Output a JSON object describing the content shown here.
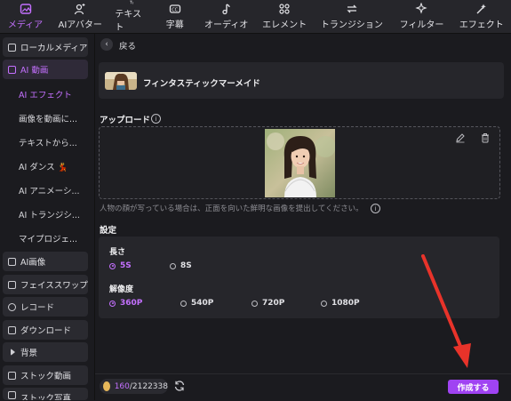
{
  "toolbar": {
    "tabs": [
      {
        "label": "メディア",
        "icon": "media-icon"
      },
      {
        "label": "AIアバター",
        "icon": "avatar-icon"
      },
      {
        "label": "テキスト",
        "icon": "text-icon"
      },
      {
        "label": "字幕",
        "icon": "subtitle-icon"
      },
      {
        "label": "オーディオ",
        "icon": "audio-icon"
      },
      {
        "label": "エレメント",
        "icon": "element-icon"
      },
      {
        "label": "トランジション",
        "icon": "transition-icon"
      },
      {
        "label": "フィルター",
        "icon": "filter-icon"
      },
      {
        "label": "エフェクト",
        "icon": "effect-icon"
      }
    ],
    "active_index": 0
  },
  "sidebar": {
    "items": [
      {
        "label": "ローカルメディア"
      },
      {
        "label": "AI 動画"
      },
      {
        "label": "AI画像"
      },
      {
        "label": "フェイススワップ"
      },
      {
        "label": "レコード"
      },
      {
        "label": "ダウンロード"
      },
      {
        "label": "背景"
      },
      {
        "label": "ストック動画"
      },
      {
        "label": "ストック写真"
      }
    ],
    "subitems": [
      {
        "label": "AI エフェクト"
      },
      {
        "label": "画像を動画に..."
      },
      {
        "label": "テキストから..."
      },
      {
        "label": "AI ダンス 💃"
      },
      {
        "label": "AI アニメーシ..."
      },
      {
        "label": "AI トランジシ..."
      },
      {
        "label": "マイプロジェ..."
      }
    ]
  },
  "main": {
    "back_label": "戻る",
    "effect_title": "フィンタスティックマーメイド",
    "upload_label": "アップロード",
    "hint": "人物の顔が写っている場合は、正面を向いた鮮明な画像を提出してください。",
    "settings_label": "設定",
    "length_label": "長さ",
    "length_options": [
      "5S",
      "8S"
    ],
    "length_selected": "5S",
    "resolution_label": "解像度",
    "resolution_options": [
      "360P",
      "540P",
      "720P",
      "1080P"
    ],
    "resolution_selected": "360P"
  },
  "footer": {
    "credits_used": "160",
    "credits_total": "/2122338",
    "create_label": "作成する"
  },
  "colors": {
    "accent": "#c470ff",
    "button": "#a043f2",
    "arrow": "#e8332a"
  }
}
